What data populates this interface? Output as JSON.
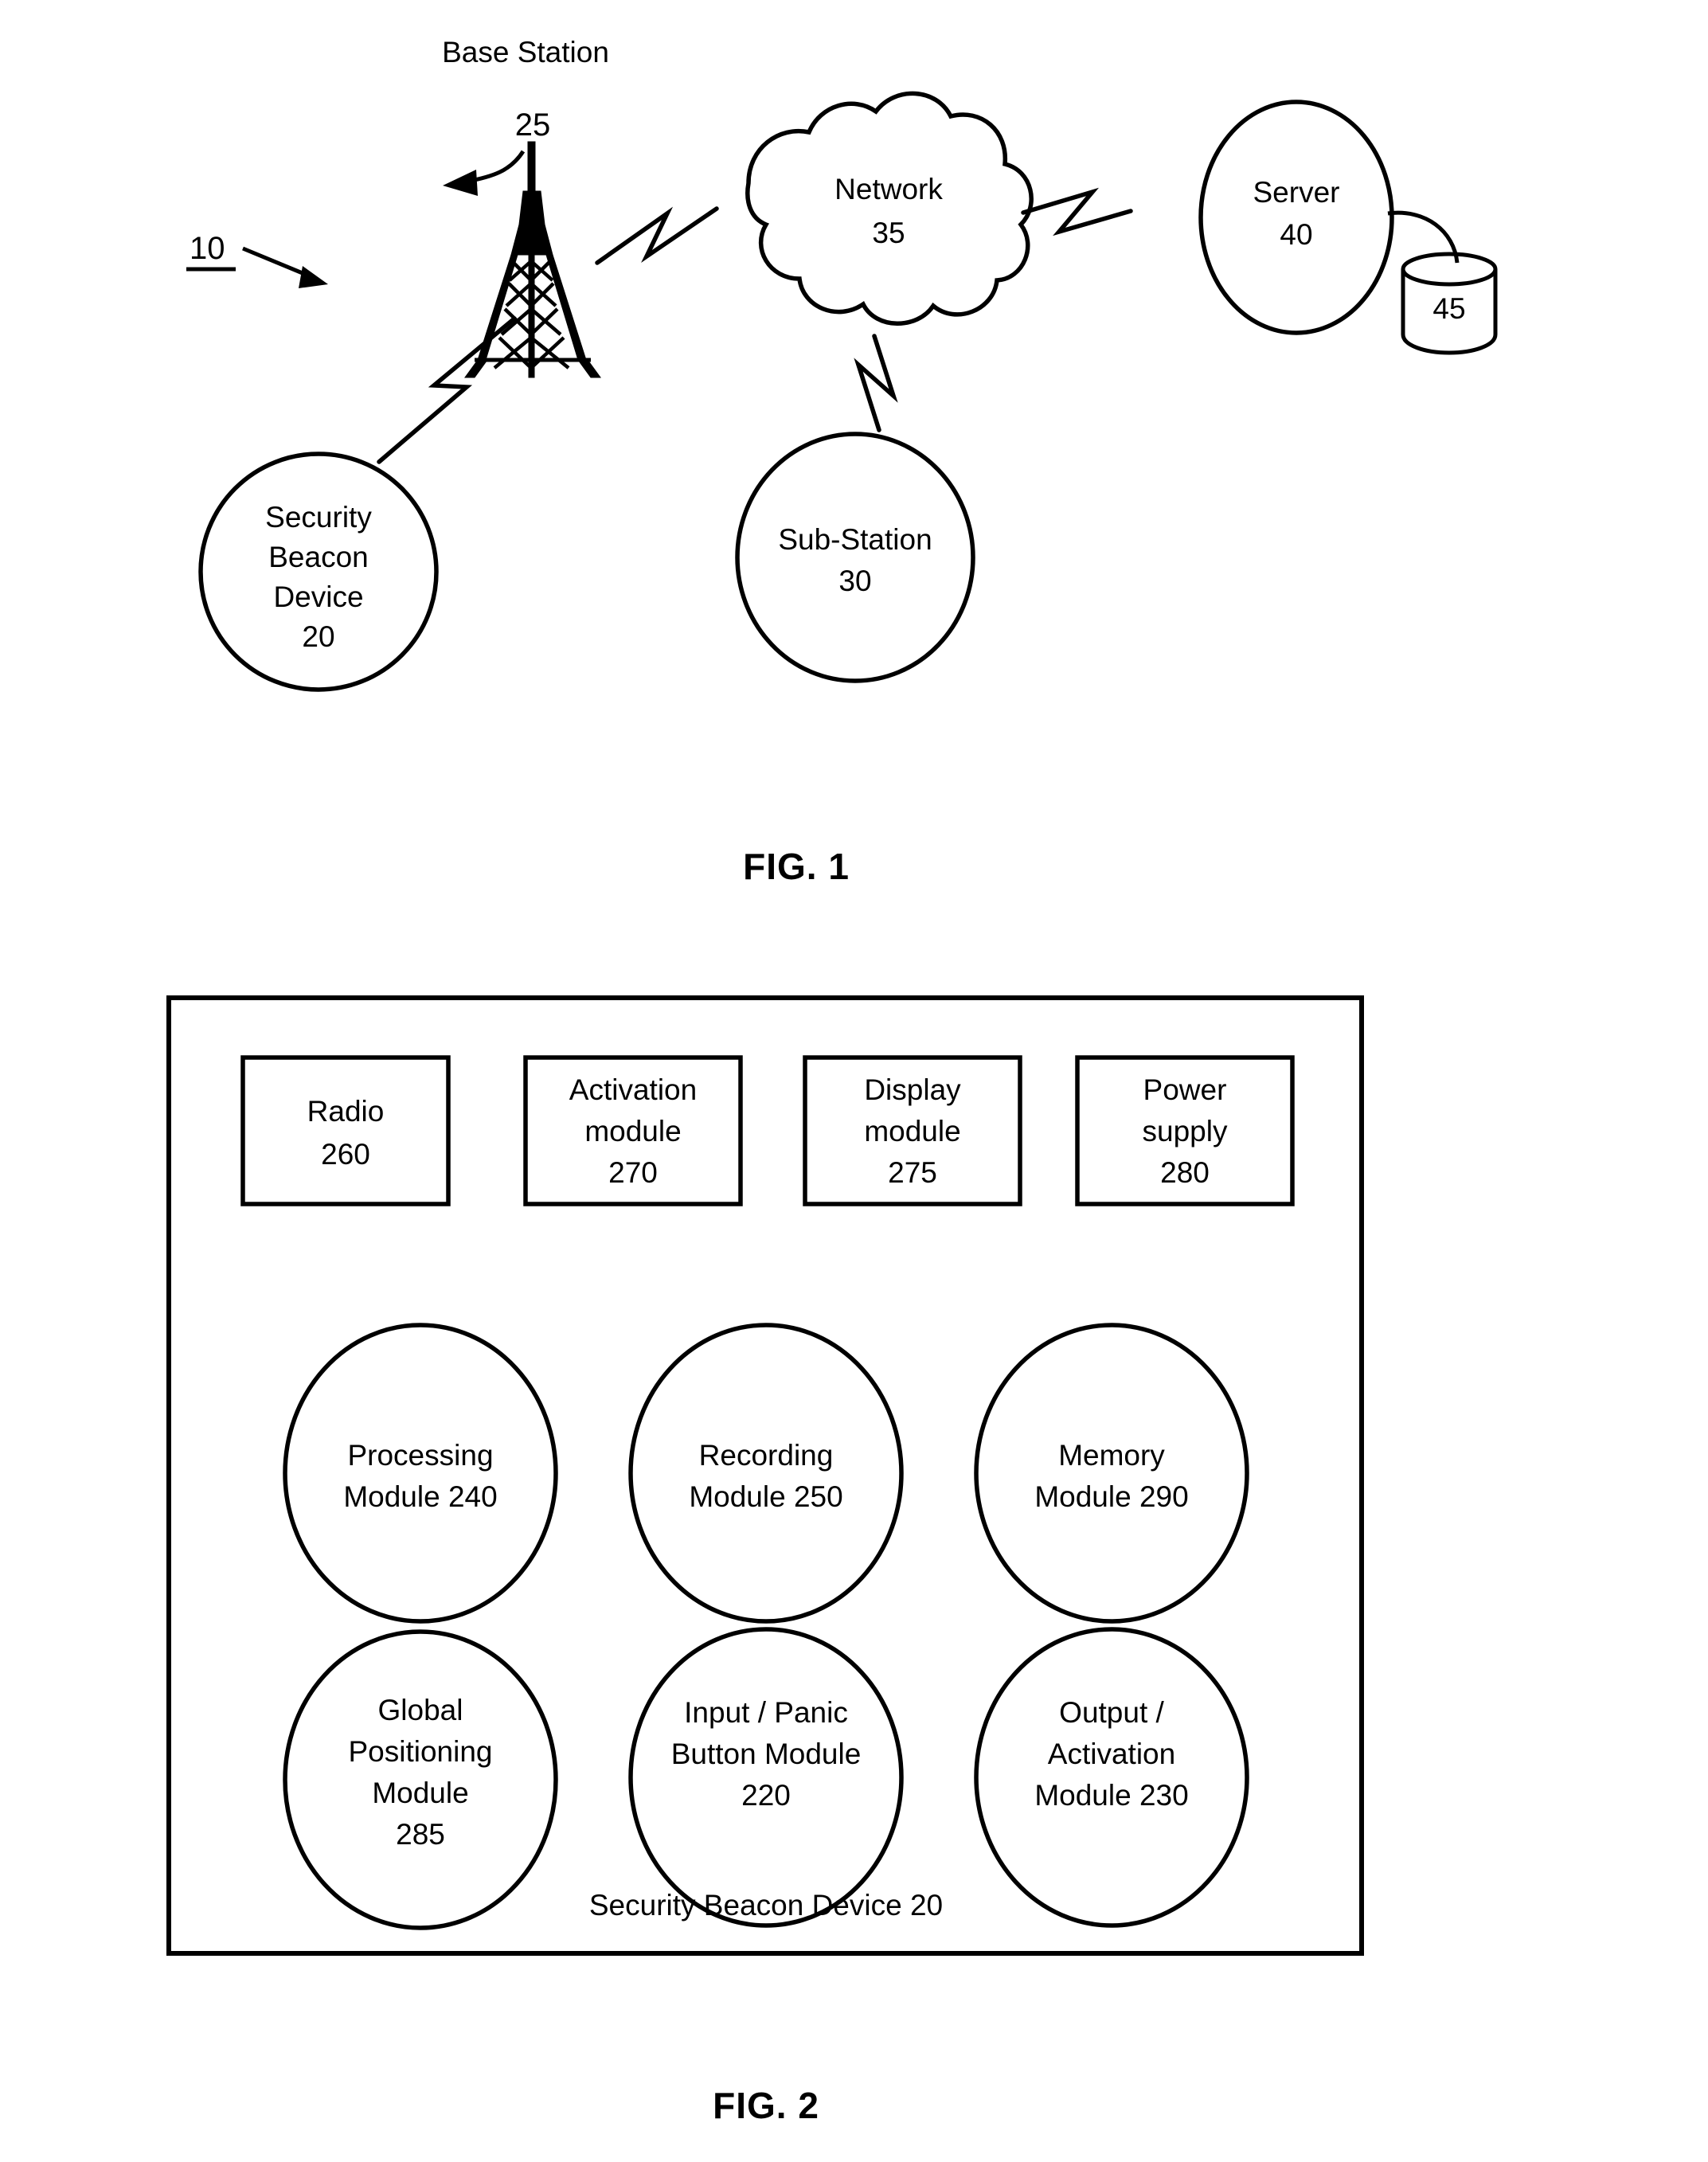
{
  "figure1": {
    "caption": "FIG. 1",
    "system_ref": "10",
    "nodes": {
      "base_station": {
        "title": "Base Station",
        "ref": "25",
        "icon": "cell-tower-icon"
      },
      "network": {
        "title": "Network",
        "ref": "35",
        "icon": "cloud-icon"
      },
      "server": {
        "title": "Server",
        "ref": "40",
        "icon": "circle-node"
      },
      "database": {
        "ref": "45",
        "icon": "database-cylinder-icon"
      },
      "security_beacon_device": {
        "line1": "Security",
        "line2": "Beacon",
        "line3": "Device",
        "ref": "20",
        "icon": "circle-node"
      },
      "sub_station": {
        "title": "Sub-Station",
        "ref": "30",
        "icon": "circle-node"
      }
    },
    "links": [
      {
        "from": "security_beacon_device",
        "to": "base_station",
        "style": "wireless-lightning"
      },
      {
        "from": "base_station",
        "to": "network",
        "style": "wireless-lightning"
      },
      {
        "from": "network",
        "to": "server",
        "style": "wireless-lightning"
      },
      {
        "from": "network",
        "to": "sub_station",
        "style": "wireless-lightning"
      },
      {
        "from": "server",
        "to": "database",
        "style": "wired-curve"
      }
    ]
  },
  "figure2": {
    "caption": "FIG. 2",
    "container_label": "Security Beacon Device 20",
    "boxes": [
      {
        "line1": "Radio",
        "line2": "",
        "ref": "260"
      },
      {
        "line1": "Activation",
        "line2": "module",
        "ref": "270"
      },
      {
        "line1": "Display",
        "line2": "module",
        "ref": "275"
      },
      {
        "line1": "Power",
        "line2": "supply",
        "ref": "280"
      }
    ],
    "circles_row1": [
      {
        "line1": "Processing",
        "line2": "Module 240",
        "line3": "",
        "line4": ""
      },
      {
        "line1": "Recording",
        "line2": "Module 250",
        "line3": "",
        "line4": ""
      },
      {
        "line1": "Memory",
        "line2": "Module 290",
        "line3": "",
        "line4": ""
      }
    ],
    "circles_row2": [
      {
        "line1": "Global",
        "line2": "Positioning",
        "line3": "Module",
        "line4": "285"
      },
      {
        "line1": "Input / Panic",
        "line2": "Button Module",
        "line3": "220",
        "line4": ""
      },
      {
        "line1": "Output /",
        "line2": "Activation",
        "line3": "Module 230",
        "line4": ""
      }
    ]
  },
  "colors": {
    "ink": "#000000",
    "paper": "#ffffff"
  }
}
